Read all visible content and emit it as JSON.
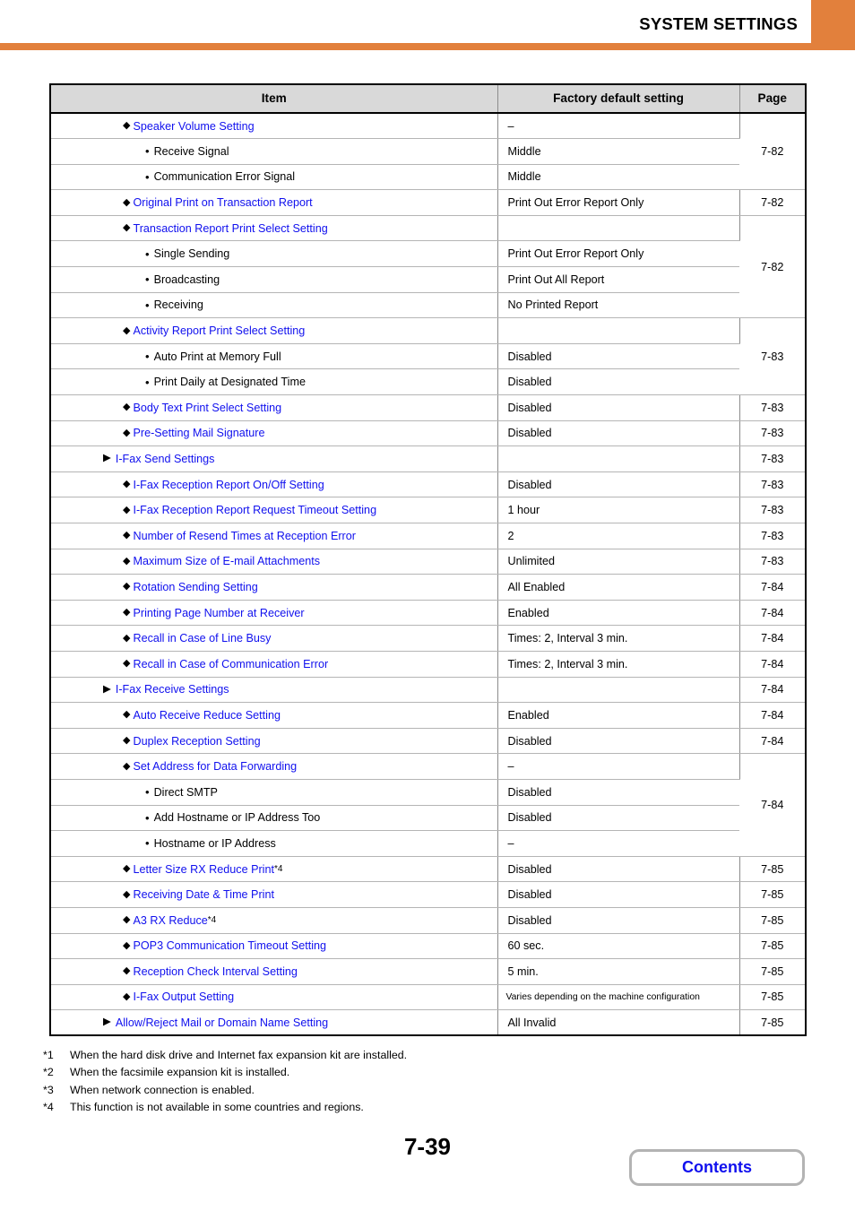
{
  "header": {
    "title": "SYSTEM SETTINGS",
    "accent_color": "#e2803c"
  },
  "table": {
    "columns": [
      "Item",
      "Factory default setting",
      "Page"
    ],
    "rows": [
      {
        "level": "diamond",
        "label": "Speaker Volume Setting",
        "link": true,
        "value": "–",
        "page": "7-82",
        "page_rowspan": 3
      },
      {
        "level": "bullet",
        "label": "Receive Signal",
        "link": false,
        "value": "Middle"
      },
      {
        "level": "bullet",
        "label": "Communication Error Signal",
        "link": false,
        "value": "Middle"
      },
      {
        "level": "diamond",
        "label": "Original Print on Transaction Report",
        "link": true,
        "value": "Print Out Error Report Only",
        "page": "7-82",
        "page_rowspan": 1
      },
      {
        "level": "diamond",
        "label": "Transaction Report Print Select Setting",
        "link": true,
        "value": "",
        "page": "7-82",
        "page_rowspan": 4
      },
      {
        "level": "bullet",
        "label": "Single Sending",
        "link": false,
        "value": "Print Out Error Report Only"
      },
      {
        "level": "bullet",
        "label": "Broadcasting",
        "link": false,
        "value": "Print Out All Report"
      },
      {
        "level": "bullet",
        "label": "Receiving",
        "link": false,
        "value": "No Printed Report"
      },
      {
        "level": "diamond",
        "label": "Activity Report Print Select Setting",
        "link": true,
        "value": "",
        "page": "7-83",
        "page_rowspan": 3
      },
      {
        "level": "bullet",
        "label": "Auto Print at Memory Full",
        "link": false,
        "value": "Disabled"
      },
      {
        "level": "bullet",
        "label": "Print Daily at Designated Time",
        "link": false,
        "value": "Disabled"
      },
      {
        "level": "diamond",
        "label": "Body Text Print Select Setting",
        "link": true,
        "value": "Disabled",
        "page": "7-83",
        "page_rowspan": 1
      },
      {
        "level": "diamond",
        "label": "Pre-Setting Mail Signature",
        "link": true,
        "value": "Disabled",
        "page": "7-83",
        "page_rowspan": 1
      },
      {
        "level": "triangle",
        "label": "I-Fax Send Settings",
        "link": true,
        "value": "",
        "page": "7-83",
        "page_rowspan": 1
      },
      {
        "level": "diamond",
        "label": "I-Fax Reception Report On/Off Setting",
        "link": true,
        "value": "Disabled",
        "page": "7-83",
        "page_rowspan": 1
      },
      {
        "level": "diamond",
        "label": "I-Fax Reception Report Request Timeout Setting",
        "link": true,
        "value": "1 hour",
        "page": "7-83",
        "page_rowspan": 1
      },
      {
        "level": "diamond",
        "label": "Number of Resend Times at Reception Error",
        "link": true,
        "value": "2",
        "page": "7-83",
        "page_rowspan": 1
      },
      {
        "level": "diamond",
        "label": "Maximum Size of E-mail Attachments",
        "link": true,
        "value": "Unlimited",
        "page": "7-83",
        "page_rowspan": 1
      },
      {
        "level": "diamond",
        "label": "Rotation Sending Setting",
        "link": true,
        "value": "All Enabled",
        "page": "7-84",
        "page_rowspan": 1
      },
      {
        "level": "diamond",
        "label": "Printing Page Number at Receiver",
        "link": true,
        "value": "Enabled",
        "page": "7-84",
        "page_rowspan": 1
      },
      {
        "level": "diamond",
        "label": "Recall in Case of Line Busy",
        "link": true,
        "value": "Times: 2, Interval 3 min.",
        "page": "7-84",
        "page_rowspan": 1
      },
      {
        "level": "diamond",
        "label": "Recall in Case of Communication Error",
        "link": true,
        "value": "Times: 2, Interval 3 min.",
        "page": "7-84",
        "page_rowspan": 1
      },
      {
        "level": "triangle",
        "label": "I-Fax Receive Settings",
        "link": true,
        "value": "",
        "page": "7-84",
        "page_rowspan": 1
      },
      {
        "level": "diamond",
        "label": "Auto Receive Reduce Setting",
        "link": true,
        "value": "Enabled",
        "page": "7-84",
        "page_rowspan": 1
      },
      {
        "level": "diamond",
        "label": "Duplex Reception Setting",
        "link": true,
        "value": "Disabled",
        "page": "7-84",
        "page_rowspan": 1
      },
      {
        "level": "diamond",
        "label": "Set Address for Data Forwarding",
        "link": true,
        "value": "–",
        "page": "7-84",
        "page_rowspan": 4
      },
      {
        "level": "bullet",
        "label": "Direct SMTP",
        "link": false,
        "value": "Disabled"
      },
      {
        "level": "bullet",
        "label": "Add Hostname or IP Address Too",
        "link": false,
        "value": "Disabled"
      },
      {
        "level": "bullet",
        "label": "Hostname or IP Address",
        "link": false,
        "value": "–"
      },
      {
        "level": "diamond",
        "label": "Letter Size RX Reduce Print",
        "link": true,
        "footnote": "*4",
        "value": "Disabled",
        "page": "7-85",
        "page_rowspan": 1
      },
      {
        "level": "diamond",
        "label": "Receiving Date & Time Print",
        "link": true,
        "value": "Disabled",
        "page": "7-85",
        "page_rowspan": 1
      },
      {
        "level": "diamond",
        "label": "A3 RX Reduce",
        "link": true,
        "footnote": "*4",
        "value": "Disabled",
        "page": "7-85",
        "page_rowspan": 1
      },
      {
        "level": "diamond",
        "label": "POP3 Communication Timeout Setting",
        "link": true,
        "value": "60 sec.",
        "page": "7-85",
        "page_rowspan": 1
      },
      {
        "level": "diamond",
        "label": "Reception Check Interval Setting",
        "link": true,
        "value": "5 min.",
        "page": "7-85",
        "page_rowspan": 1
      },
      {
        "level": "diamond",
        "label": "I-Fax Output Setting",
        "link": true,
        "value": "Varies depending on the machine configuration",
        "value_small": true,
        "page": "7-85",
        "page_rowspan": 1
      },
      {
        "level": "triangle",
        "label": "Allow/Reject Mail or Domain Name Setting",
        "link": true,
        "value": "All Invalid",
        "page": "7-85",
        "page_rowspan": 1
      }
    ]
  },
  "footnotes": [
    {
      "mark": "*1",
      "text": "When the hard disk drive and Internet fax expansion kit are installed."
    },
    {
      "mark": "*2",
      "text": "When the facsimile expansion kit is installed."
    },
    {
      "mark": "*3",
      "text": "When network connection is enabled."
    },
    {
      "mark": "*4",
      "text": "This function is not available in some countries and regions."
    }
  ],
  "footer": {
    "page_number": "7-39",
    "contents_label": "Contents"
  },
  "icons": {
    "triangle": "▶",
    "diamond": "◆",
    "bullet": "•"
  }
}
